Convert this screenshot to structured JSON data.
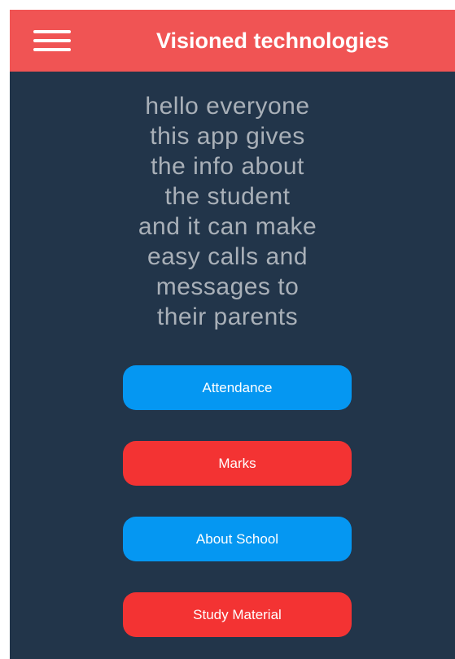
{
  "header": {
    "title": "Visioned technologies",
    "menu_icon": "hamburger-menu-icon",
    "background_color": "#f05454"
  },
  "intro": {
    "lines": [
      "hello everyone",
      "this app gives",
      "the info about",
      "the student",
      "and it can make",
      "easy calls and",
      "messages to",
      "their parents"
    ]
  },
  "buttons": [
    {
      "label": "Attendance",
      "color": "#0597f2"
    },
    {
      "label": "Marks",
      "color": "#f33333"
    },
    {
      "label": "About School",
      "color": "#0597f2"
    },
    {
      "label": "Study Material",
      "color": "#f33333"
    }
  ],
  "theme": {
    "background": "#22354a",
    "intro_text_color": "#a9b0b8"
  }
}
